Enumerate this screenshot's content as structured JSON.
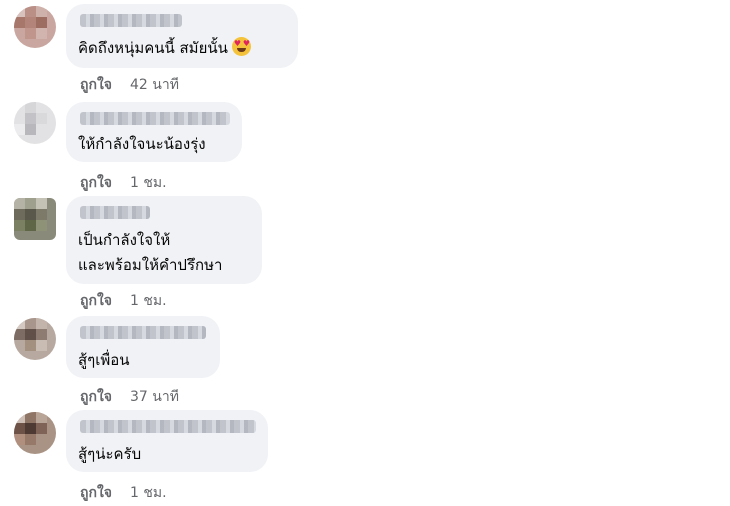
{
  "comments": [
    {
      "text_lines": [
        "คิดถึงหนุ่มคนนี้ สมัยนั้น"
      ],
      "emoji": "heart-eyes-emoji",
      "like_label": "ถูกใจ",
      "time": "42 นาที"
    },
    {
      "text_lines": [
        "ให้กำลังใจนะน้องรุ่ง"
      ],
      "like_label": "ถูกใจ",
      "time": "1 ชม."
    },
    {
      "text_lines": [
        "เป็นกำลังใจให้",
        "และพร้อมให้คำปรึกษา"
      ],
      "like_label": "ถูกใจ",
      "time": "1 ชม."
    },
    {
      "text_lines": [
        "สู้ๆเพื่อน"
      ],
      "like_label": "ถูกใจ",
      "time": "37 นาที"
    },
    {
      "text_lines": [
        "สู้ๆน่ะครับ"
      ],
      "like_label": "ถูกใจ",
      "time": "1 ชม."
    }
  ],
  "colors": {
    "bubble": "#f0f2f5",
    "text": "#050505",
    "meta": "#65676b"
  }
}
